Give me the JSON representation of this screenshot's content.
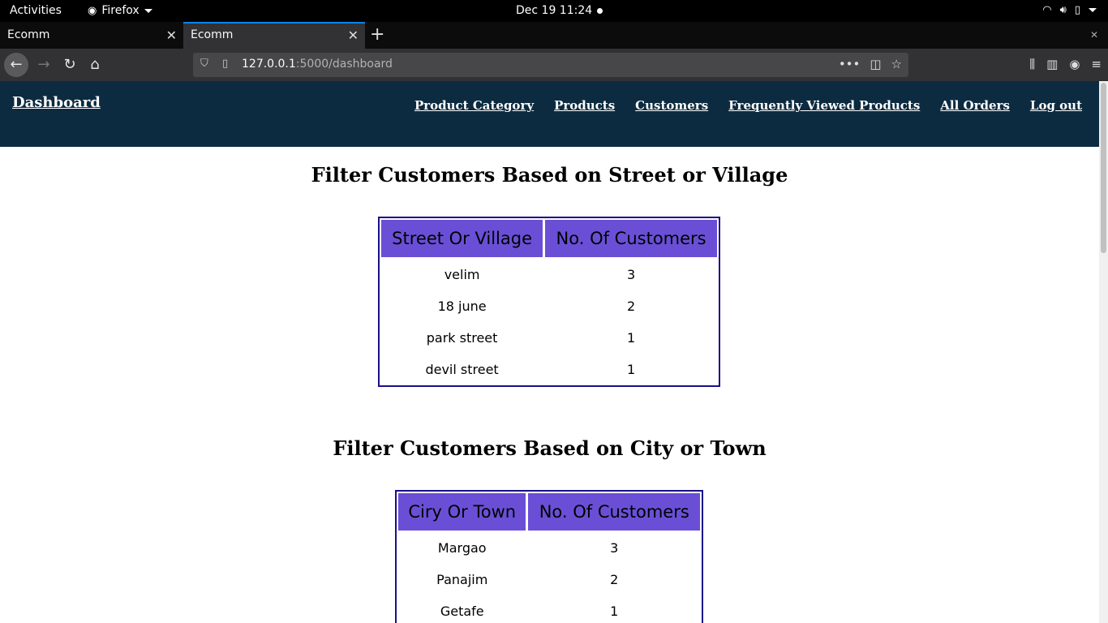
{
  "system": {
    "activities": "Activities",
    "app_name": "Firefox",
    "clock": "Dec 19  11:24"
  },
  "browser": {
    "tabs": [
      {
        "title": "Ecomm",
        "active": false
      },
      {
        "title": "Ecomm",
        "active": true
      }
    ],
    "url_host": "127.0.0.1",
    "url_rest": ":5000/dashboard"
  },
  "site": {
    "brand": "Dashboard",
    "nav": [
      "Product Category",
      "Products",
      "Customers",
      "Frequently Viewed Products",
      "All Orders",
      "Log out"
    ]
  },
  "street_section": {
    "heading": "Filter Customers Based on Street or Village",
    "columns": [
      "Street Or Village",
      "No. Of Customers"
    ],
    "rows": [
      [
        "velim",
        "3"
      ],
      [
        "18 june",
        "2"
      ],
      [
        "park street",
        "1"
      ],
      [
        "devil street",
        "1"
      ]
    ]
  },
  "city_section": {
    "heading": "Filter Customers Based on City or Town",
    "columns": [
      "Ciry Or Town",
      "No. Of Customers"
    ],
    "rows": [
      [
        "Margao",
        "3"
      ],
      [
        "Panajim",
        "2"
      ],
      [
        "Getafe",
        "1"
      ]
    ]
  },
  "colors": {
    "header_bg": "#0c2b40",
    "table_header_bg": "#6a4fd6",
    "table_border": "#1a0f8a",
    "tab_accent": "#0a84ff"
  }
}
